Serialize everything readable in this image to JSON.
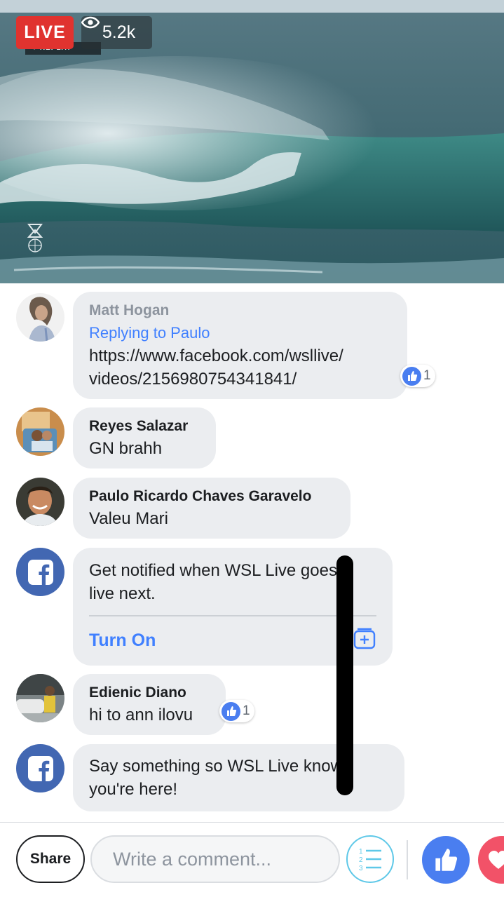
{
  "video": {
    "live_label": "LIVE",
    "view_count": "5.2k",
    "icons": {
      "views": "eye-icon"
    }
  },
  "comments": [
    {
      "author": "Matt Hogan",
      "reply_to": "Replying to Paulo",
      "text_lines": [
        "https://www.facebook.com/wsllive/",
        "videos/2156980754341841/"
      ],
      "likes": "1"
    },
    {
      "author": "Reyes Salazar",
      "text_lines": [
        "GN brahh"
      ]
    },
    {
      "author": "Paulo Ricardo Chaves Garavelo",
      "text_lines": [
        "Valeu Mari"
      ]
    },
    {
      "author": "",
      "text_lines": [
        "Get notified when WSL Live goes",
        "live next."
      ],
      "action": "Turn On",
      "icons": {
        "avatar": "facebook-logo-icon",
        "action": "calendar-add-icon"
      }
    },
    {
      "author": "Edienic Diano",
      "text_lines": [
        "hi to ann ilovu"
      ],
      "likes": "1"
    },
    {
      "author": "",
      "text_lines": [
        "Say something so WSL Live knows",
        "you're here!"
      ],
      "icons": {
        "avatar": "facebook-logo-icon"
      }
    }
  ],
  "composer": {
    "share_label": "Share",
    "placeholder": "Write a comment...",
    "icons": {
      "list": "numbered-list-icon",
      "like": "thumbs-up-icon",
      "love": "heart-icon"
    }
  },
  "colors": {
    "live": "#e0332f",
    "facebook_blue": "#4267b2",
    "link_blue": "#4080ff",
    "like_blue": "#4a7ef0",
    "love_red": "#f25268"
  }
}
